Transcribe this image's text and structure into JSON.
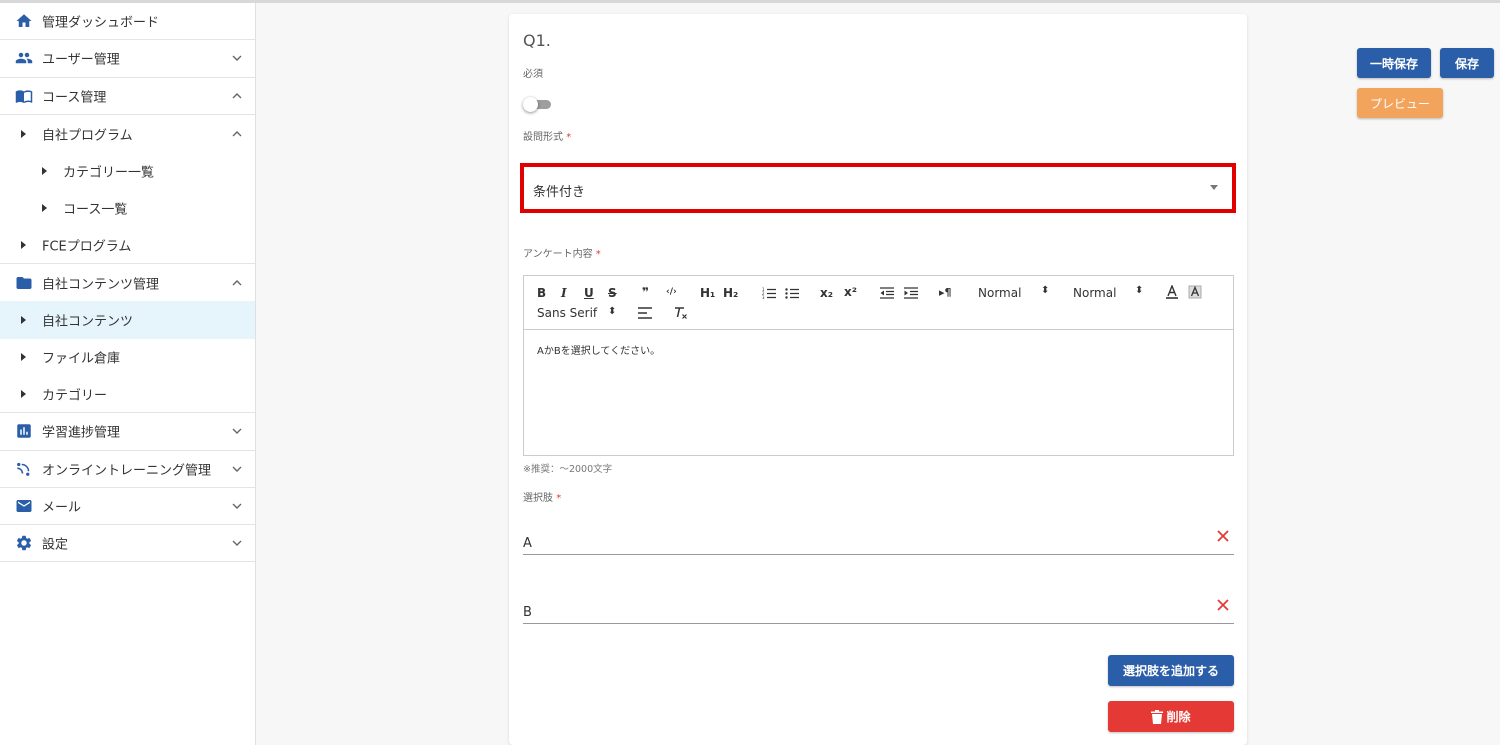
{
  "sidebar": {
    "items": [
      {
        "label": "管理ダッシュボード",
        "icon": "home-icon"
      },
      {
        "label": "ユーザー管理",
        "icon": "users-icon",
        "chevron": "down"
      },
      {
        "label": "コース管理",
        "icon": "book-icon",
        "chevron": "up"
      },
      {
        "label": "自社プログラム",
        "chevron": "up"
      },
      {
        "label": "カテゴリー一覧"
      },
      {
        "label": "コース一覧"
      },
      {
        "label": "FCEプログラム"
      },
      {
        "label": "自社コンテンツ管理",
        "icon": "folder-icon",
        "chevron": "up"
      },
      {
        "label": "自社コンテンツ",
        "active": true
      },
      {
        "label": "ファイル倉庫"
      },
      {
        "label": "カテゴリー"
      },
      {
        "label": "学習進捗管理",
        "icon": "bar-chart-icon",
        "chevron": "down"
      },
      {
        "label": "オンライントレーニング管理",
        "icon": "broadcast-icon",
        "chevron": "down"
      },
      {
        "label": "メール",
        "icon": "mail-icon",
        "chevron": "down"
      },
      {
        "label": "設定",
        "icon": "gear-icon",
        "chevron": "down"
      }
    ]
  },
  "question": {
    "title": "Q1.",
    "required_label": "必須",
    "required_on": false,
    "format_label": "設問形式",
    "format_value": "条件付き",
    "content_label": "アンケート内容",
    "content_text": "AかBを選択してください。",
    "content_hint": "※推奨：～2000文字",
    "choices_label": "選択肢",
    "choices": [
      "A",
      "B"
    ],
    "required_mark": "*"
  },
  "editor_toolbar": {
    "bold": "B",
    "italic": "I",
    "underline": "U",
    "strike": "S",
    "quote": "❞",
    "code": "‹/›",
    "h1": "H₁",
    "h2": "H₂",
    "sub": "x₂",
    "sup": "x²",
    "rtl": "▸¶",
    "size": "Normal",
    "header": "Normal",
    "font": "Sans Serif"
  },
  "actions": {
    "add_choice": "選択肢を追加する",
    "delete": "削除",
    "temp_save": "一時保存",
    "save": "保存",
    "preview": "プレビュー"
  },
  "colors": {
    "primary": "#2a5ea8",
    "danger": "#e53935",
    "warning": "#f3a45c",
    "highlight": "#e00000"
  }
}
